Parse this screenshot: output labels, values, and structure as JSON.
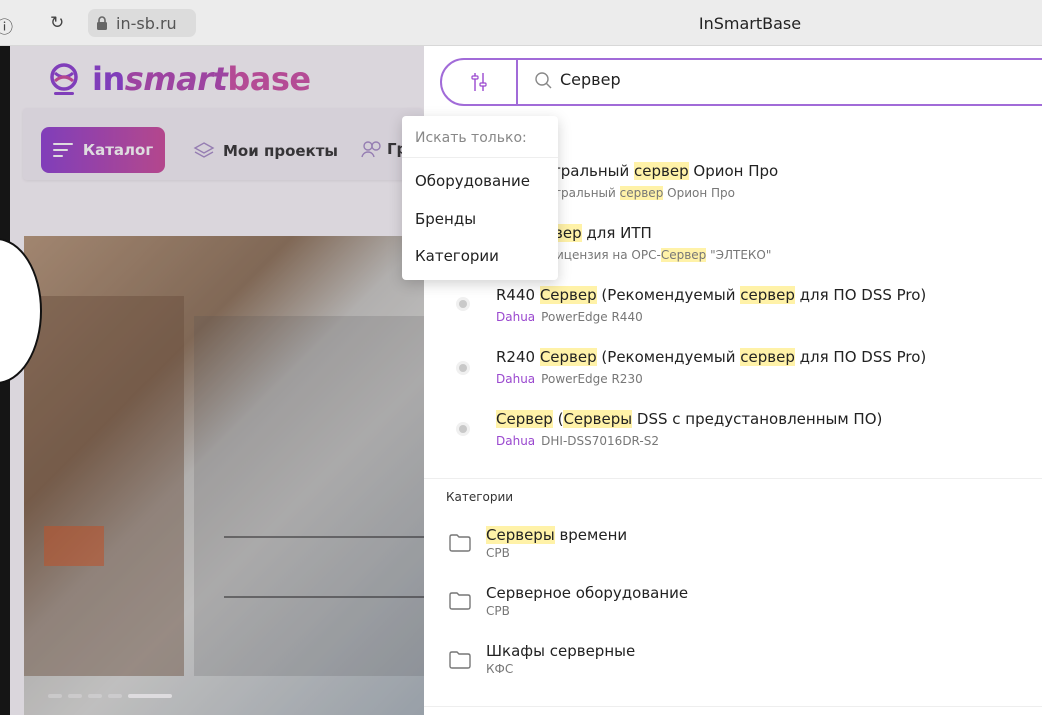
{
  "browser": {
    "url": "in-sb.ru",
    "title": "InSmartBase",
    "icons": [
      "info-icon",
      "reload-icon",
      "lock-icon"
    ]
  },
  "site": {
    "logo_prefix": "in",
    "logo_italic": "smart",
    "logo_suffix": "base",
    "nav": {
      "catalog": "Каталог",
      "projects": "Мои проекты",
      "groups_partial": "Гр"
    },
    "carousel_dots": 5,
    "carousel_active": 5
  },
  "search": {
    "query": "Сервер",
    "filter_menu": {
      "header": "Искать только:",
      "options": [
        "Оборудование",
        "Бренды",
        "Категории"
      ]
    }
  },
  "products": [
    {
      "title_pre": "тральный ",
      "title_hl": "сервер",
      "title_post": " Орион Про",
      "sub_brand": "",
      "sub_pre": "тральный ",
      "sub_hl": "сервер",
      "sub_post": " Орион Про"
    },
    {
      "title_pre": "",
      "title_hl": "вер",
      "title_post": " для ИТП",
      "sub_brand": "",
      "sub_pre": "ицензия на ОРС-",
      "sub_hl": "Сервер",
      "sub_post": " \"ЭЛТЕКО\""
    },
    {
      "title_pre": "R440 ",
      "title_hl": "Сервер",
      "title_mid": " (Рекомендуемый ",
      "title_hl2": "сервер",
      "title_post": " для ПО DSS Pro)",
      "sub_brand": "Dahua",
      "sub_model": "PowerEdge R440"
    },
    {
      "title_pre": "R240 ",
      "title_hl": "Сервер",
      "title_mid": " (Рекомендуемый ",
      "title_hl2": "сервер",
      "title_post": " для ПО DSS Pro)",
      "sub_brand": "Dahua",
      "sub_model": "PowerEdge R230"
    },
    {
      "title_pre": "",
      "title_hl": "Сервер",
      "title_mid": " (",
      "title_hl2": "Серверы",
      "title_post": " DSS с предустановленным ПО)",
      "sub_brand": "Dahua",
      "sub_model": "DHI-DSS7016DR-S2"
    }
  ],
  "categories_section": "Категории",
  "categories": [
    {
      "hl": "Серверы",
      "rest": " времени",
      "code": "СРВ"
    },
    {
      "hl": "",
      "rest": "Серверное оборудование",
      "code": "СРВ"
    },
    {
      "hl": "",
      "rest": "Шкафы серверные",
      "code": "КФС"
    }
  ],
  "colors": {
    "accent": "#9a48cf",
    "highlight": "#fff2a8"
  }
}
